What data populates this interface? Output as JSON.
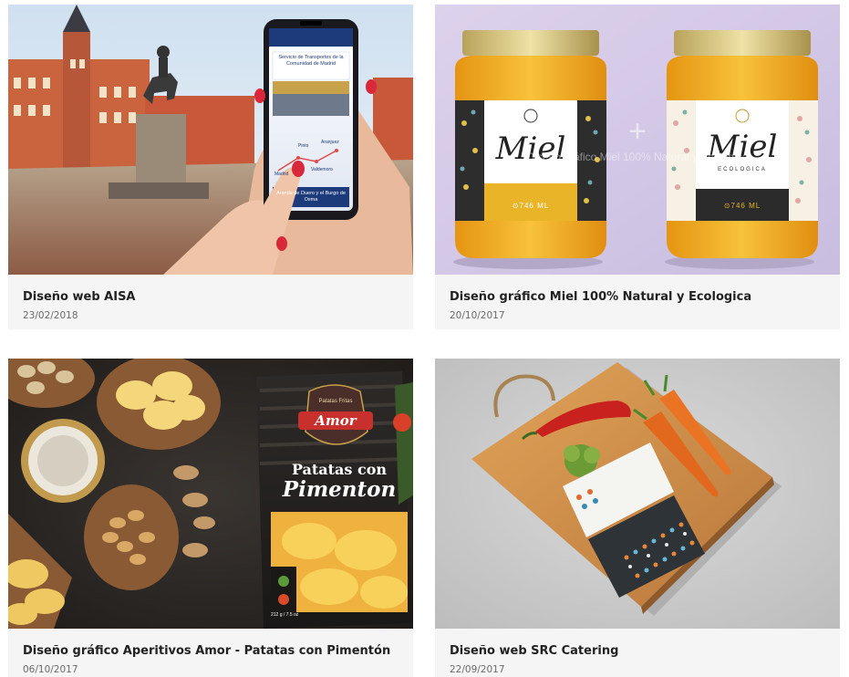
{
  "projects": [
    {
      "title": "Diseño web AISA",
      "date": "23/02/2018",
      "phone": {
        "header": "Servicio de Transportes de la Comunidad de Madrid",
        "routes": [
          "Pinto",
          "Aranjuez",
          "Madrid",
          "Valdemoro"
        ],
        "footer": "Aranda de Duero y el Burgo de Osma"
      }
    },
    {
      "title": "Diseño gráfico Miel 100% Natural y Ecologica",
      "date": "20/10/2017",
      "overlay_text": "Diseño gráfico Miel 100% Natural y Ecologica",
      "jar_left": {
        "brand": "Miel",
        "size": "⊙746 ML"
      },
      "jar_right": {
        "brand": "Miel",
        "sub": "ECOLOGICA",
        "size": "⊙746 ML"
      }
    },
    {
      "title": "Diseño gráfico Aperitivos Amor - Patatas con Pimentón",
      "date": "06/10/2017",
      "bag": {
        "top": "Patatas Fritas",
        "brand": "Amor",
        "line1": "Patatas con",
        "line2": "Pimenton",
        "weight": "212 g / 7.5 oz"
      }
    },
    {
      "title": "Diseño web SRC Catering",
      "date": "22/09/2017"
    }
  ],
  "colors": {
    "card_bg": "#f5f5f5",
    "title": "#222222",
    "date": "#6a6a6a",
    "honey": "#f2a818",
    "lid": "#c9b46a",
    "board": "#c9853e"
  }
}
